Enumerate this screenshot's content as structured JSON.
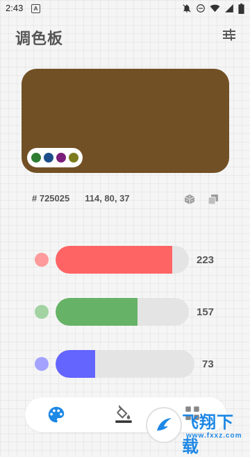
{
  "status_bar": {
    "time": "2:43",
    "app_icon_letter": "A",
    "icons": [
      "notifications-off-icon",
      "do-not-disturb-icon",
      "wifi-icon",
      "signal-icon",
      "battery-icon"
    ]
  },
  "header": {
    "title": "调色板",
    "settings_icon": "sliders-icon"
  },
  "preview": {
    "color": "#725025",
    "swatches": [
      "#2e7d32",
      "#1d4e89",
      "#7b1f7a",
      "#7c7c1e"
    ]
  },
  "info": {
    "hex": "# 725025",
    "rgb": "114, 80, 37",
    "random_icon": "dice-icon",
    "copy_icon": "copy-icon"
  },
  "sliders": [
    {
      "channel": "red",
      "value": "223",
      "fraction": 0.874,
      "fill_color": "#ff6464",
      "dot_color": "#ff9a9a"
    },
    {
      "channel": "green",
      "value": "157",
      "fraction": 0.616,
      "fill_color": "#66b266",
      "dot_color": "#a3d3a3"
    },
    {
      "channel": "blue",
      "value": "73",
      "fraction": 0.286,
      "fill_color": "#6464ff",
      "dot_color": "#a3a3ff"
    }
  ],
  "bottom_nav": {
    "tabs": [
      "palette-icon",
      "fill-bucket-icon",
      "grid-icon"
    ],
    "active_color": "#1e88e5"
  },
  "watermark": {
    "text": "飞翔下载",
    "url": "www.fxxz.com"
  }
}
